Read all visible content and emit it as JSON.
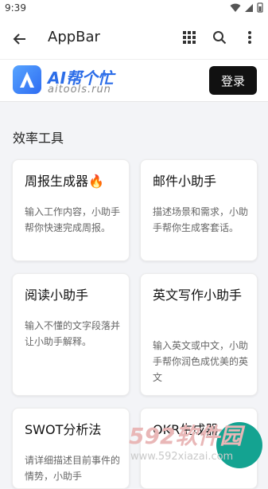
{
  "status": {
    "time": "9:39"
  },
  "appbar": {
    "title": "AppBar"
  },
  "brand": {
    "title": "AI帮个忙",
    "subtitle": "aitools.run",
    "login": "登录"
  },
  "section": {
    "title": "效率工具"
  },
  "cards": [
    {
      "title": "周报生成器🔥",
      "desc": "输入工作内容，小助手帮你快速完成周报。"
    },
    {
      "title": "邮件小助手",
      "desc": "描述场景和需求，小助手帮你生成客套话。"
    },
    {
      "title": "阅读小助手",
      "desc": "输入不懂的文字段落并让小助手解释。"
    },
    {
      "title": "英文写作小助手",
      "desc": "输入英文或中文，小助手帮你润色成优美的英文"
    },
    {
      "title": "SWOT分析法",
      "desc": "请详细描述目前事件的情势，小助手"
    },
    {
      "title": "OKR生成器",
      "desc": ""
    }
  ],
  "watermark": {
    "big": "592软件园",
    "url": "www.592xiazai.com"
  }
}
